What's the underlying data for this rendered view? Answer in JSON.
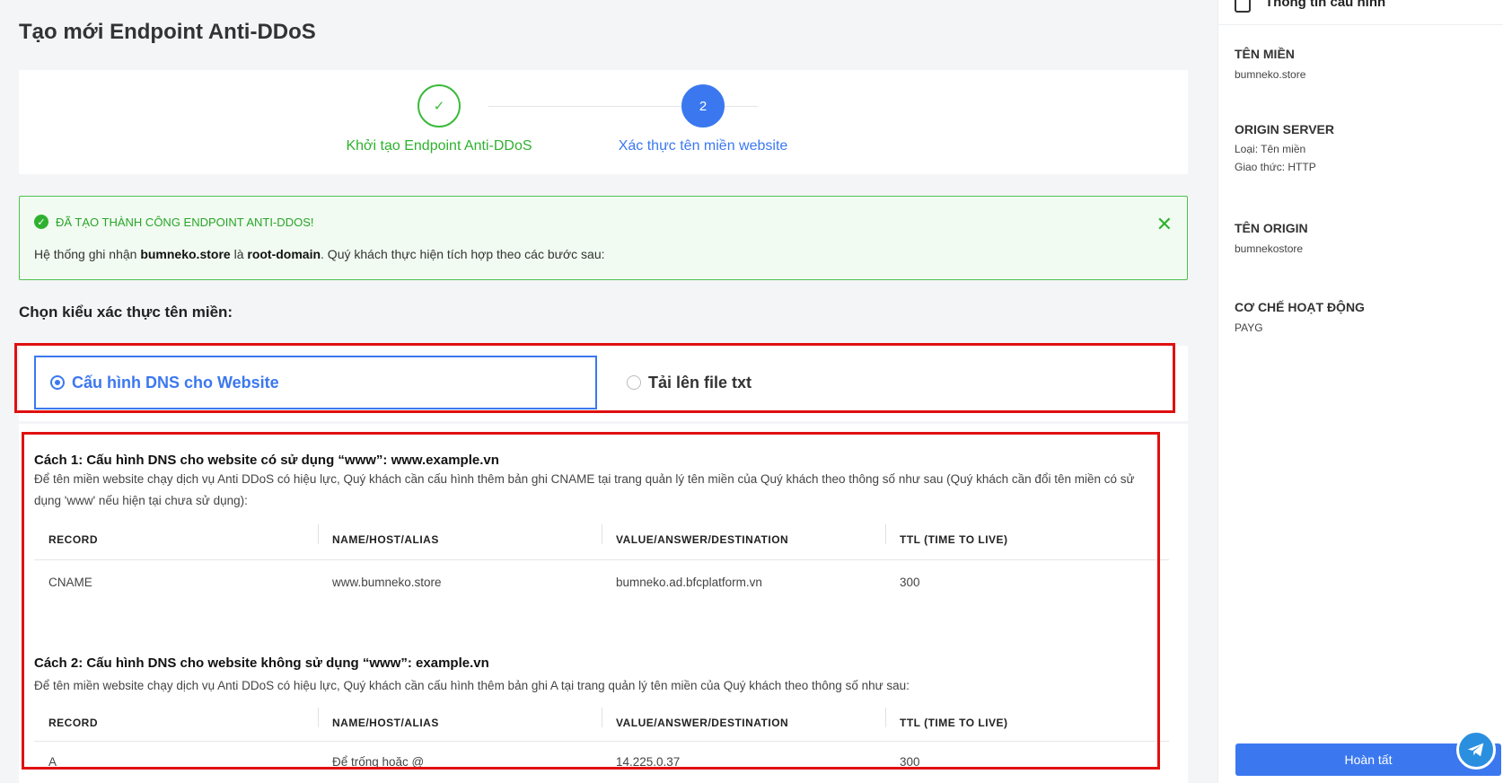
{
  "page_title": "Tạo mới Endpoint Anti-DDoS",
  "stepper": {
    "steps": [
      {
        "number": "✓",
        "label": "Khởi tạo Endpoint Anti-DDoS",
        "state": "done"
      },
      {
        "number": "2",
        "label": "Xác thực tên miền website",
        "state": "active"
      }
    ]
  },
  "alert": {
    "title": "ĐÃ TẠO THÀNH CÔNG ENDPOINT ANTI-DDOS!",
    "msg_prefix": "Hệ thống ghi nhận ",
    "domain": "bumneko.store",
    "msg_middle": " là ",
    "root": "root-domain",
    "msg_suffix": ". Quý khách thực hiện tích hợp theo các bước sau:",
    "close": "✕"
  },
  "section_title": "Chọn kiểu xác thực tên miền:",
  "options": [
    {
      "label": "Cấu hình DNS cho Website",
      "selected": true
    },
    {
      "label": "Tải lên file txt",
      "selected": false
    }
  ],
  "way1": {
    "title": "Cách 1: Cấu hình DNS cho website có sử dụng “www”: www.example.vn",
    "desc": "Để tên miền website chạy dịch vụ Anti DDoS có hiệu lực, Quý khách cần cấu hình thêm bản ghi CNAME tại trang quản lý tên miền của Quý khách theo thông số như sau (Quý khách cần đổi tên miền có sử dụng 'www' nếu hiện tại chưa sử dụng):",
    "headers": [
      "RECORD",
      "NAME/HOST/ALIAS",
      "VALUE/ANSWER/DESTINATION",
      "TTL (TIME TO LIVE)"
    ],
    "row": [
      "CNAME",
      "www.bumneko.store",
      "bumneko.ad.bfcplatform.vn",
      "300"
    ]
  },
  "way2": {
    "title": "Cách 2: Cấu hình DNS cho website không sử dụng “www”: example.vn",
    "desc": "Để tên miền website chạy dịch vụ Anti DDoS có hiệu lực, Quý khách cần cấu hình thêm bản ghi A tại trang quản lý tên miền của Quý khách theo thông số như sau:",
    "headers": [
      "RECORD",
      "NAME/HOST/ALIAS",
      "VALUE/ANSWER/DESTINATION",
      "TTL (TIME TO LIVE)"
    ],
    "row": [
      "A",
      "Để trống hoặc @",
      "14.225.0.37",
      "300"
    ]
  },
  "sidebar": {
    "title": "Thông tin cấu hình",
    "domain_label": "TÊN MIỀN",
    "domain_value": "bumneko.store",
    "origin_label": "ORIGIN SERVER",
    "origin_type": "Loại: Tên miền",
    "origin_protocol": "Giao thức: HTTP",
    "origin_name_label": "TÊN ORIGIN",
    "origin_name_value": "bumnekostore",
    "mechanism_label": "CƠ CHẾ HOẠT ĐỘNG",
    "mechanism_value": "PAYG",
    "finish_button": "Hoàn tất"
  },
  "icons": {
    "check": "check-icon",
    "close": "close-icon",
    "clipboard": "clipboard-icon",
    "telegram": "telegram-icon"
  },
  "colors": {
    "primary": "#3b78f0",
    "success": "#2fb12f",
    "highlight_border": "#e01010"
  }
}
